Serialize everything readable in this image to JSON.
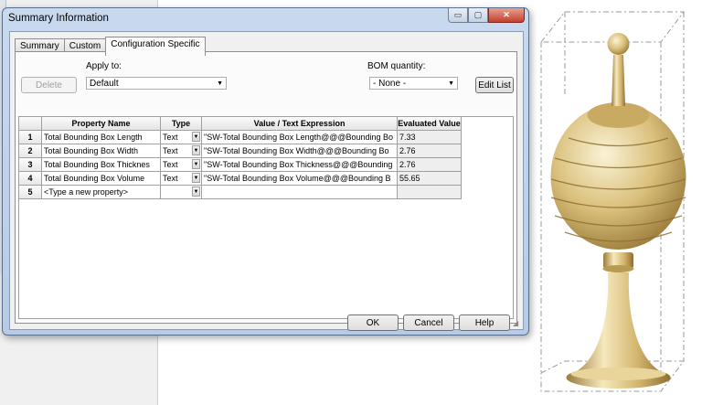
{
  "dialog": {
    "title": "Summary Information",
    "window_buttons": {
      "minimize": "▭",
      "restore": "▢",
      "close": "✕"
    },
    "tabs": [
      {
        "label": "Summary"
      },
      {
        "label": "Custom"
      },
      {
        "label": "Configuration Specific"
      }
    ],
    "delete_label": "Delete",
    "apply_to_label": "Apply to:",
    "apply_to_value": "Default",
    "bom_label": "BOM quantity:",
    "bom_value": "- None -",
    "edit_list_label": "Edit List",
    "ok_label": "OK",
    "cancel_label": "Cancel",
    "help_label": "Help"
  },
  "grid": {
    "headers": {
      "name": "Property Name",
      "type": "Type",
      "expr": "Value / Text Expression",
      "eval": "Evaluated Value"
    },
    "rows": [
      {
        "num": "1",
        "name": "Total Bounding Box Length",
        "type": "Text",
        "expr": "\"SW-Total Bounding Box Length@@@Bounding Bo",
        "eval": "7.33"
      },
      {
        "num": "2",
        "name": "Total Bounding Box Width",
        "type": "Text",
        "expr": "\"SW-Total Bounding Box Width@@@Bounding Bo",
        "eval": "2.76"
      },
      {
        "num": "3",
        "name": "Total Bounding Box Thicknes",
        "type": "Text",
        "expr": "\"SW-Total Bounding Box Thickness@@@Bounding",
        "eval": "2.76"
      },
      {
        "num": "4",
        "name": "Total Bounding Box Volume",
        "type": "Text",
        "expr": "\"SW-Total Bounding Box Volume@@@Bounding B",
        "eval": "55.65"
      },
      {
        "num": "5",
        "name": "<Type a new property>",
        "type": "",
        "expr": "",
        "eval": ""
      }
    ]
  },
  "colors": {
    "model_gold": "#d9bf7a",
    "model_highlight": "#fbf3d6",
    "model_shadow": "#9a7a3a",
    "frame_gray": "#9a9a9a",
    "dialog_border": "#59708e"
  }
}
